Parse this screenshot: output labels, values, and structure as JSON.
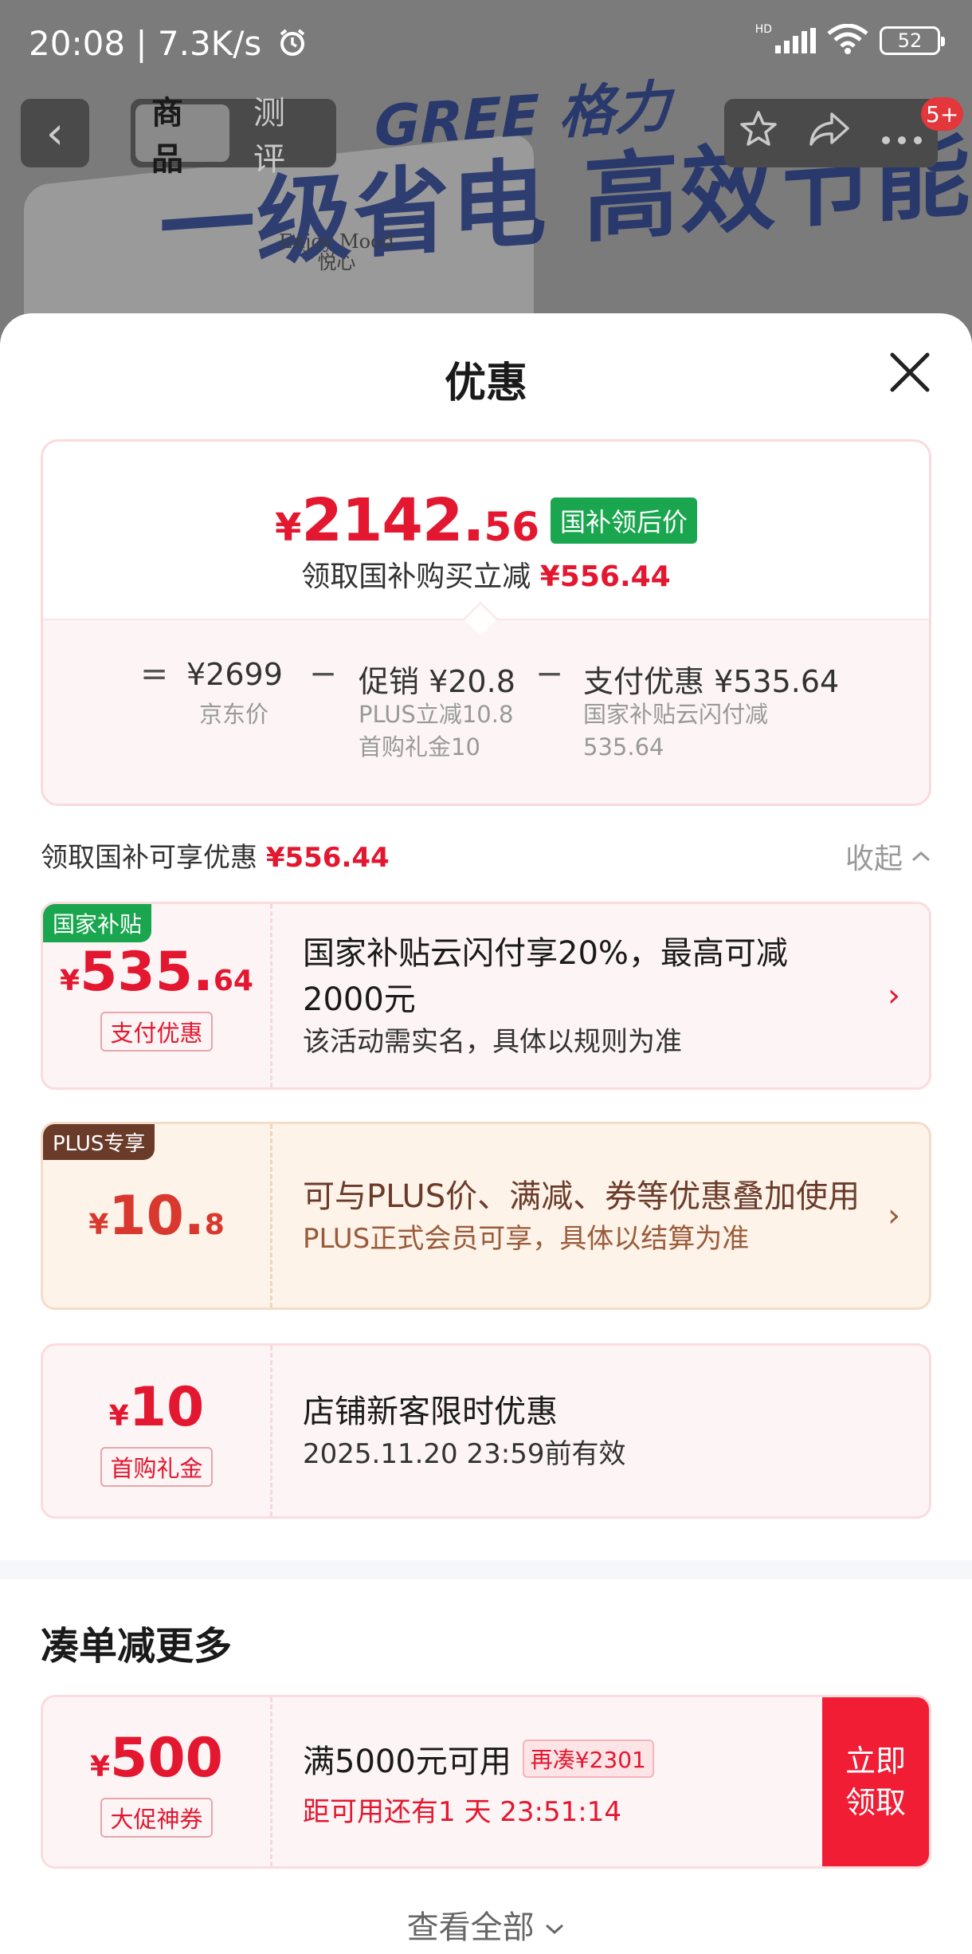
{
  "status_bar": {
    "time": "20:08 | 7.3K/s",
    "network": "HD",
    "battery": "52"
  },
  "background": {
    "brand": "GREE 格力",
    "slogan": "一级省电 高效节能",
    "product_label_line1": "Enjoy Mood",
    "product_label_line2": "悦心"
  },
  "nav": {
    "tabs": [
      {
        "label": "商品"
      },
      {
        "label": "测评"
      }
    ],
    "badge": "5+"
  },
  "sheet": {
    "title": "优惠"
  },
  "summary": {
    "price_currency": "¥",
    "price_int": "2142.",
    "price_dec": "56",
    "price_tag": "国补领后价",
    "sub_text": "领取国补购买立减",
    "sub_amount": "¥556.44",
    "calc": {
      "equals": "=",
      "jd_price": "¥2699",
      "jd_label": "京东价",
      "minus1": "−",
      "promo": "促销 ¥20.8",
      "promo_note1": "PLUS立减10.8",
      "promo_note2": "首购礼金10",
      "minus2": "−",
      "pay": "支付优惠 ¥535.64",
      "pay_note1": "国家补贴云闪付减",
      "pay_note2": "535.64"
    }
  },
  "section": {
    "label": "领取国补可享优惠",
    "amount": "¥556.44",
    "toggle": "收起"
  },
  "cards": [
    {
      "corner": "国家补贴",
      "cur": "¥",
      "int": "535.",
      "dec": "64",
      "badge": "支付优惠",
      "title": "国家补贴云闪付享20%，最高可减2000元",
      "desc": "该活动需实名，具体以规则为准"
    },
    {
      "corner": "PLUS专享",
      "cur": "¥",
      "int": "10.",
      "dec": "8",
      "title": "可与PLUS价、满减、券等优惠叠加使用",
      "desc": "PLUS正式会员可享，具体以结算为准"
    },
    {
      "cur": "¥",
      "int": "10",
      "badge": "首购礼金",
      "title": "店铺新客限时优惠",
      "desc": "2025.11.20 23:59前有效"
    }
  ],
  "more": {
    "title": "凑单减更多",
    "coupon": {
      "cur": "¥",
      "int": "500",
      "badge": "大促神券",
      "title": "满5000元可用",
      "tag": "再凑¥2301",
      "countdown": "距可用还有1 天 23:51:14",
      "button_line1": "立即",
      "button_line2": "领取"
    },
    "view_all": "查看全部"
  },
  "colors": {
    "accent_red": "#e3172f",
    "subsidy_green": "#1aa64f",
    "plus_brown": "#6b3b2a"
  }
}
